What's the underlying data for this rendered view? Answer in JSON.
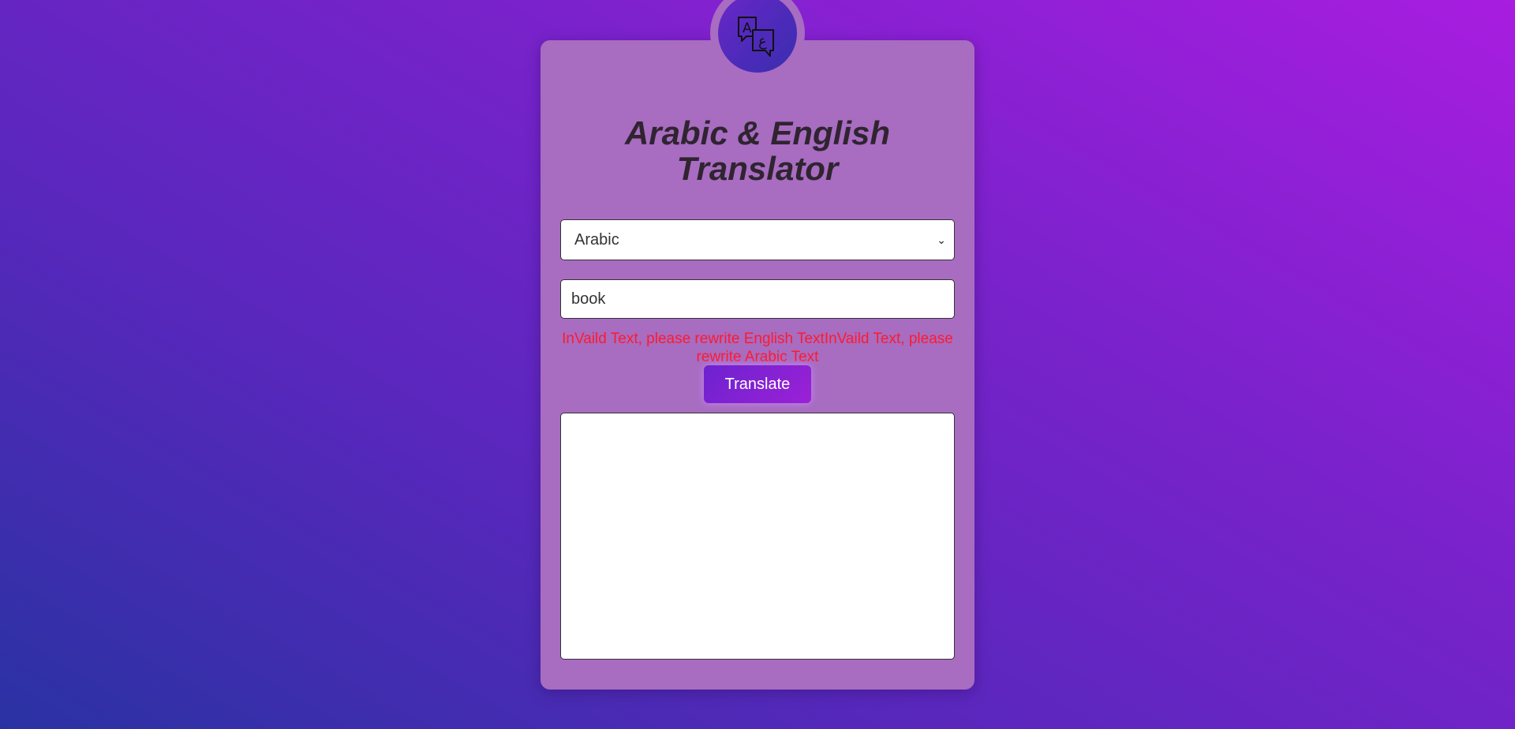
{
  "app": {
    "title": "Arabic & English Translator"
  },
  "language_select": {
    "selected": "Arabic",
    "chevron_icon": "chevron-down-icon"
  },
  "input": {
    "value": "book",
    "placeholder": ""
  },
  "error_message": "InVaild Text, please rewrite English TextInVaild Text, please rewrite Arabic Text",
  "translate_button": {
    "label": "Translate"
  },
  "output": {
    "value": ""
  },
  "logo": {
    "icon": "translate-icon",
    "glyph_latin": "A",
    "glyph_arabic": "ع"
  },
  "colors": {
    "card_bg": "#a86cc1",
    "error": "#ff1a2e",
    "button_gradient_start": "#6d22d0",
    "button_gradient_end": "#9b21d6",
    "title": "#2f2430"
  }
}
